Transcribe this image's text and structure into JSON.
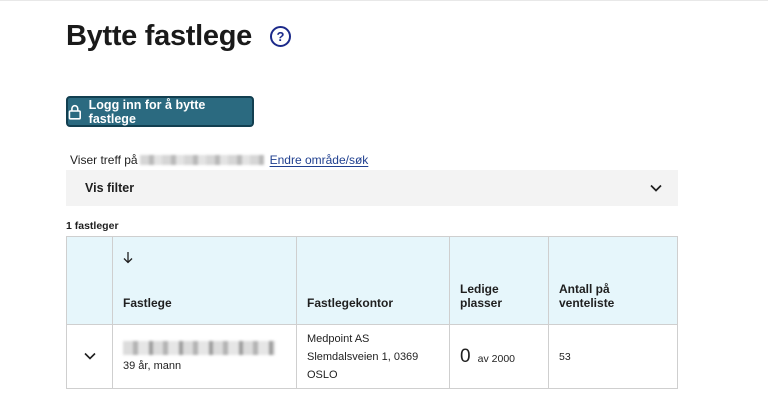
{
  "page": {
    "title": "Bytte fastlege",
    "help_icon": "question-circle-icon"
  },
  "login_button": {
    "label": "Logg inn for å bytte fastlege",
    "icon": "lock-icon",
    "color": "#2b6a80"
  },
  "location": {
    "prefix": "Viser treff på",
    "change_link": "Endre område/søk"
  },
  "filter": {
    "label": "Vis filter",
    "icon": "chevron-down-icon"
  },
  "results": {
    "count_label": "1 fastleger",
    "columns": [
      "Fastlege",
      "Fastlegekontor",
      "Ledige plasser",
      "Antall på venteliste"
    ],
    "sort_icon": "arrow-down-icon",
    "header_color": "#e6f6fb",
    "rows": [
      {
        "doctor_info": "39 år, mann",
        "office_name": "Medpoint AS",
        "office_address": "Slemdalsveien 1, 0369 OSLO",
        "available_count": "0",
        "available_total": "av 2000",
        "waitlist": "53"
      }
    ]
  }
}
